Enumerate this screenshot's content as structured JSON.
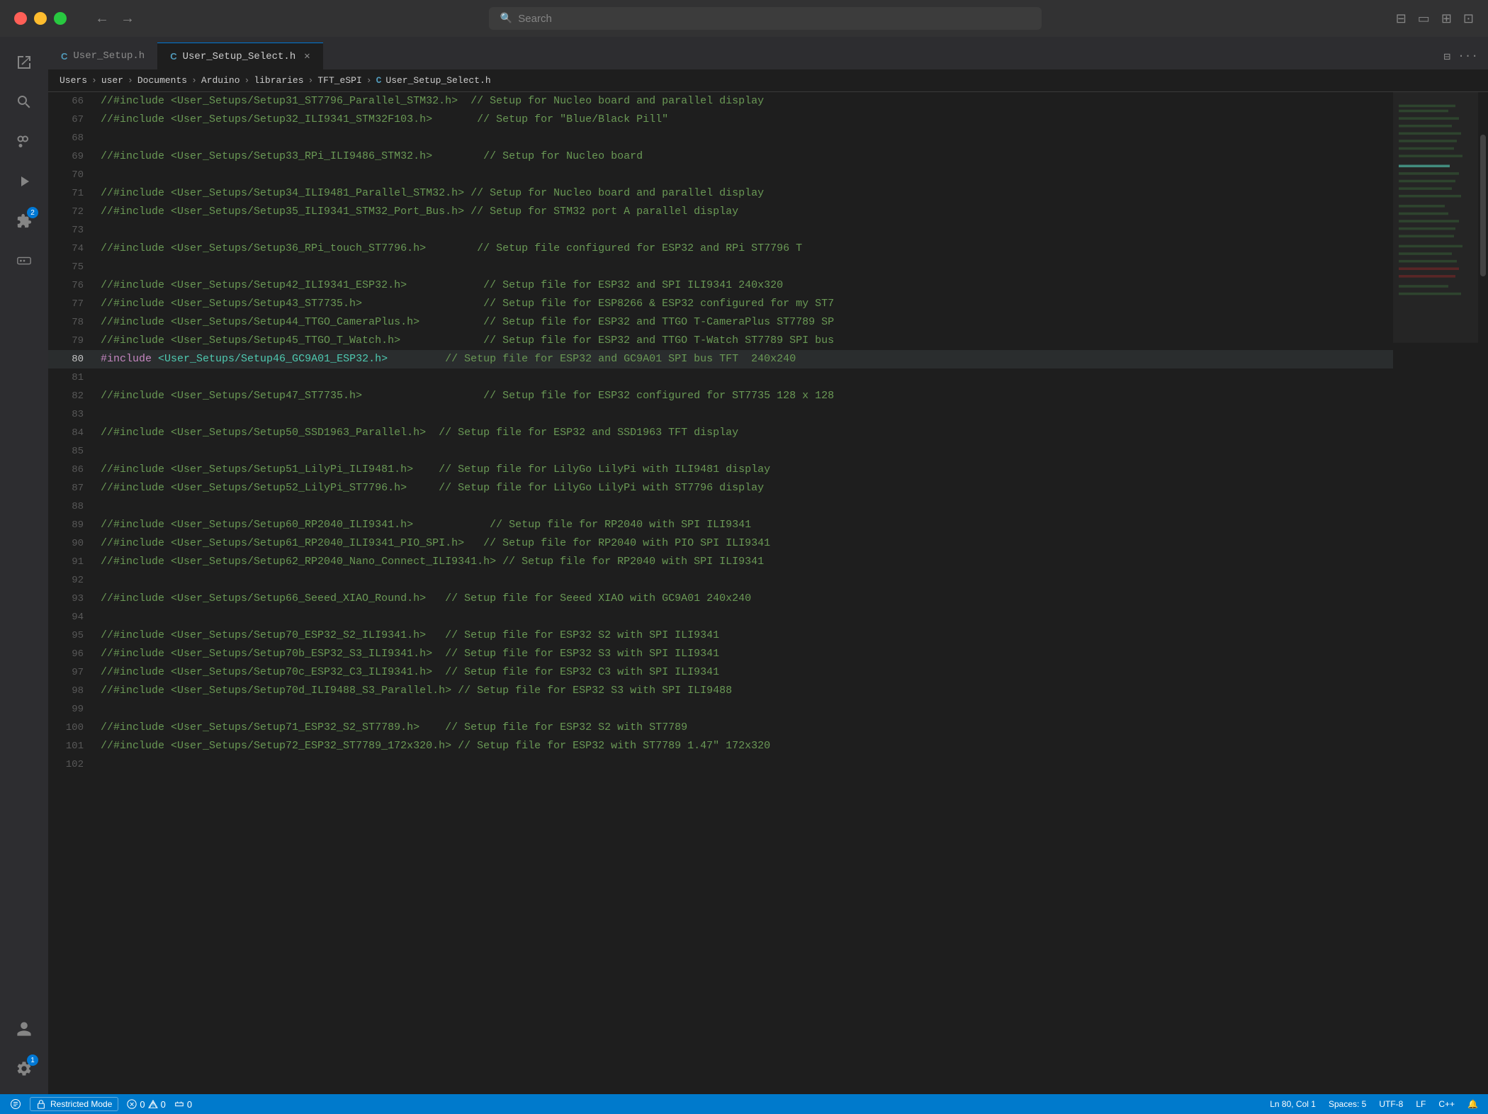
{
  "titleBar": {
    "searchPlaceholder": "Search",
    "navBack": "←",
    "navForward": "→"
  },
  "tabs": [
    {
      "id": "tab1",
      "label": "User_Setup.h",
      "lang": "C",
      "active": false,
      "modified": false
    },
    {
      "id": "tab2",
      "label": "User_Setup_Select.h",
      "lang": "C",
      "active": true,
      "modified": false,
      "closable": true
    }
  ],
  "breadcrumb": {
    "parts": [
      "Users",
      "user",
      "Documents",
      "Arduino",
      "libraries",
      "TFT_eSPI",
      "User_Setup_Select.h"
    ],
    "separators": [
      ">",
      ">",
      ">",
      ">",
      ">",
      ">"
    ]
  },
  "activityBar": {
    "icons": [
      {
        "name": "files-icon",
        "label": "Explorer",
        "active": false
      },
      {
        "name": "search-icon",
        "label": "Search",
        "active": false
      },
      {
        "name": "source-control-icon",
        "label": "Source Control",
        "active": false
      },
      {
        "name": "run-icon",
        "label": "Run",
        "active": false
      },
      {
        "name": "extensions-icon",
        "label": "Extensions",
        "active": false,
        "badge": "2"
      },
      {
        "name": "remote-icon",
        "label": "Remote Explorer",
        "active": false
      }
    ],
    "bottomIcons": [
      {
        "name": "account-icon",
        "label": "Account"
      },
      {
        "name": "settings-icon",
        "label": "Settings",
        "badge": "1"
      }
    ]
  },
  "codeLines": [
    {
      "num": 66,
      "content": "//#include <User_Setups/Setup31_ST7796_Parallel_STM32.h>  // Setup for Nucleo board and parallel display",
      "active": false
    },
    {
      "num": 67,
      "content": "//#include <User_Setups/Setup32_ILI9341_STM32F103.h>       // Setup for \"Blue/Black Pill\"",
      "active": false
    },
    {
      "num": 68,
      "content": "",
      "active": false
    },
    {
      "num": 69,
      "content": "//#include <User_Setups/Setup33_RPi_ILI9486_STM32.h>        // Setup for Nucleo board",
      "active": false
    },
    {
      "num": 70,
      "content": "",
      "active": false
    },
    {
      "num": 71,
      "content": "//#include <User_Setups/Setup34_ILI9481_Parallel_STM32.h> // Setup for Nucleo board and parallel display",
      "active": false
    },
    {
      "num": 72,
      "content": "//#include <User_Setups/Setup35_ILI9341_STM32_Port_Bus.h> // Setup for STM32 port A parallel display",
      "active": false
    },
    {
      "num": 73,
      "content": "",
      "active": false
    },
    {
      "num": 74,
      "content": "//#include <User_Setups/Setup36_RPi_touch_ST7796.h>        // Setup file configured for ESP32 and RPi ST7796 T",
      "active": false
    },
    {
      "num": 75,
      "content": "",
      "active": false
    },
    {
      "num": 76,
      "content": "//#include <User_Setups/Setup42_ILI9341_ESP32.h>            // Setup file for ESP32 and SPI ILI9341 240x320",
      "active": false
    },
    {
      "num": 77,
      "content": "//#include <User_Setups/Setup43_ST7735.h>                   // Setup file for ESP8266 & ESP32 configured for my ST7",
      "active": false
    },
    {
      "num": 78,
      "content": "//#include <User_Setups/Setup44_TTGO_CameraPlus.h>          // Setup file for ESP32 and TTGO T-CameraPlus ST7789 SP",
      "active": false
    },
    {
      "num": 79,
      "content": "//#include <User_Setups/Setup45_TTGO_T_Watch.h>             // Setup file for ESP32 and TTGO T-Watch ST7789 SPI bus",
      "active": false
    },
    {
      "num": 80,
      "content": "#include <User_Setups/Setup46_GC9A01_ESP32.h>         // Setup file for ESP32 and GC9A01 SPI bus TFT  240x240",
      "active": true
    },
    {
      "num": 81,
      "content": "",
      "active": false
    },
    {
      "num": 82,
      "content": "//#include <User_Setups/Setup47_ST7735.h>                   // Setup file for ESP32 configured for ST7735 128 x 128",
      "active": false
    },
    {
      "num": 83,
      "content": "",
      "active": false
    },
    {
      "num": 84,
      "content": "//#include <User_Setups/Setup50_SSD1963_Parallel.h>  // Setup file for ESP32 and SSD1963 TFT display",
      "active": false
    },
    {
      "num": 85,
      "content": "",
      "active": false
    },
    {
      "num": 86,
      "content": "//#include <User_Setups/Setup51_LilyPi_ILI9481.h>    // Setup file for LilyGo LilyPi with ILI9481 display",
      "active": false
    },
    {
      "num": 87,
      "content": "//#include <User_Setups/Setup52_LilyPi_ST7796.h>     // Setup file for LilyGo LilyPi with ST7796 display",
      "active": false
    },
    {
      "num": 88,
      "content": "",
      "active": false
    },
    {
      "num": 89,
      "content": "//#include <User_Setups/Setup60_RP2040_ILI9341.h>            // Setup file for RP2040 with SPI ILI9341",
      "active": false
    },
    {
      "num": 90,
      "content": "//#include <User_Setups/Setup61_RP2040_ILI9341_PIO_SPI.h>   // Setup file for RP2040 with PIO SPI ILI9341",
      "active": false
    },
    {
      "num": 91,
      "content": "//#include <User_Setups/Setup62_RP2040_Nano_Connect_ILI9341.h> // Setup file for RP2040 with SPI ILI9341",
      "active": false
    },
    {
      "num": 92,
      "content": "",
      "active": false
    },
    {
      "num": 93,
      "content": "//#include <User_Setups/Setup66_Seeed_XIAO_Round.h>   // Setup file for Seeed XIAO with GC9A01 240x240",
      "active": false
    },
    {
      "num": 94,
      "content": "",
      "active": false
    },
    {
      "num": 95,
      "content": "//#include <User_Setups/Setup70_ESP32_S2_ILI9341.h>   // Setup file for ESP32 S2 with SPI ILI9341",
      "active": false
    },
    {
      "num": 96,
      "content": "//#include <User_Setups/Setup70b_ESP32_S3_ILI9341.h>  // Setup file for ESP32 S3 with SPI ILI9341",
      "active": false
    },
    {
      "num": 97,
      "content": "//#include <User_Setups/Setup70c_ESP32_C3_ILI9341.h>  // Setup file for ESP32 C3 with SPI ILI9341",
      "active": false
    },
    {
      "num": 98,
      "content": "//#include <User_Setups/Setup70d_ILI9488_S3_Parallel.h> // Setup file for ESP32 S3 with SPI ILI9488",
      "active": false
    },
    {
      "num": 99,
      "content": "",
      "active": false
    },
    {
      "num": 100,
      "content": "//#include <User_Setups/Setup71_ESP32_S2_ST7789.h>    // Setup file for ESP32 S2 with ST7789",
      "active": false
    },
    {
      "num": 101,
      "content": "//#include <User_Setups/Setup72_ESP32_ST7789_172x320.h> // Setup file for ESP32 with ST7789 1.47\" 172x320",
      "active": false
    },
    {
      "num": 102,
      "content": "",
      "active": false
    }
  ],
  "statusBar": {
    "restrictedMode": "Restricted Mode",
    "errors": "0",
    "warnings": "0",
    "ports": "0",
    "line": "Ln 80, Col 1",
    "spaces": "Spaces: 5",
    "encoding": "UTF-8",
    "lineEnding": "LF",
    "language": "C++",
    "bell": "🔔"
  }
}
